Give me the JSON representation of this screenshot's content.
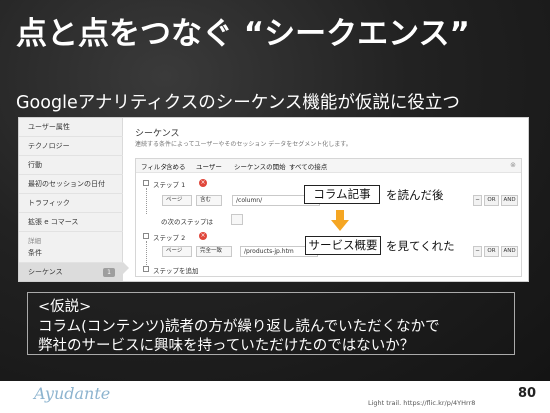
{
  "slide": {
    "title": "点と点をつなぐ “シークエンス”",
    "subtitle": "Googleアナリティクスのシーケンス機能が仮説に役立つ",
    "page_number": "80",
    "logo_text": "Ayudante",
    "credit": "Light trail. https://flic.kr/p/4YHrr8"
  },
  "sidebar": {
    "items": [
      "ユーザー属性",
      "テクノロジー",
      "行動",
      "最初のセッションの日付",
      "トラフィック",
      "拡張 e コマース"
    ],
    "section_label": "詳細",
    "advanced_items": [
      "条件",
      "シーケンス"
    ],
    "sequence_badge": "1"
  },
  "main": {
    "heading": "シーケンス",
    "description": "連続する条件によってユーザーやそのセッション データをセグメント化します。",
    "filter_bar": {
      "filter": "フィルタ",
      "include": "含める",
      "users": "ユーザー",
      "sequence_start": "シーケンスの開始",
      "all_hits": "すべての接点",
      "close": "⊗"
    },
    "step1": {
      "label": "ステップ 1",
      "dim": "ページ",
      "match": "含む",
      "value": "/column/"
    },
    "next_step": "の次のステップは",
    "step2": {
      "label": "ステップ 2",
      "dim": "ページ",
      "match": "完全一致",
      "value": "/products-jp.htm"
    },
    "add_step": "ステップを追加",
    "or_label": "OR",
    "and_label": "AND",
    "minus_label": "−"
  },
  "callouts": {
    "column_article": "コラム記事",
    "read_then": "を読んだ後",
    "service_overview": "サービス概要",
    "viewed": "を見てくれた"
  },
  "hypothesis": {
    "heading": "<仮説>",
    "line1": "コラム(コンテンツ)読者の方が繰り返し読んでいただくなかで",
    "line2": "弊社のサービスに興味を持っていただけたのではないか？"
  },
  "colors": {
    "accent_orange": "#f5a623",
    "logo_blue": "#8db4cf",
    "remove_red": "#e0463a"
  }
}
